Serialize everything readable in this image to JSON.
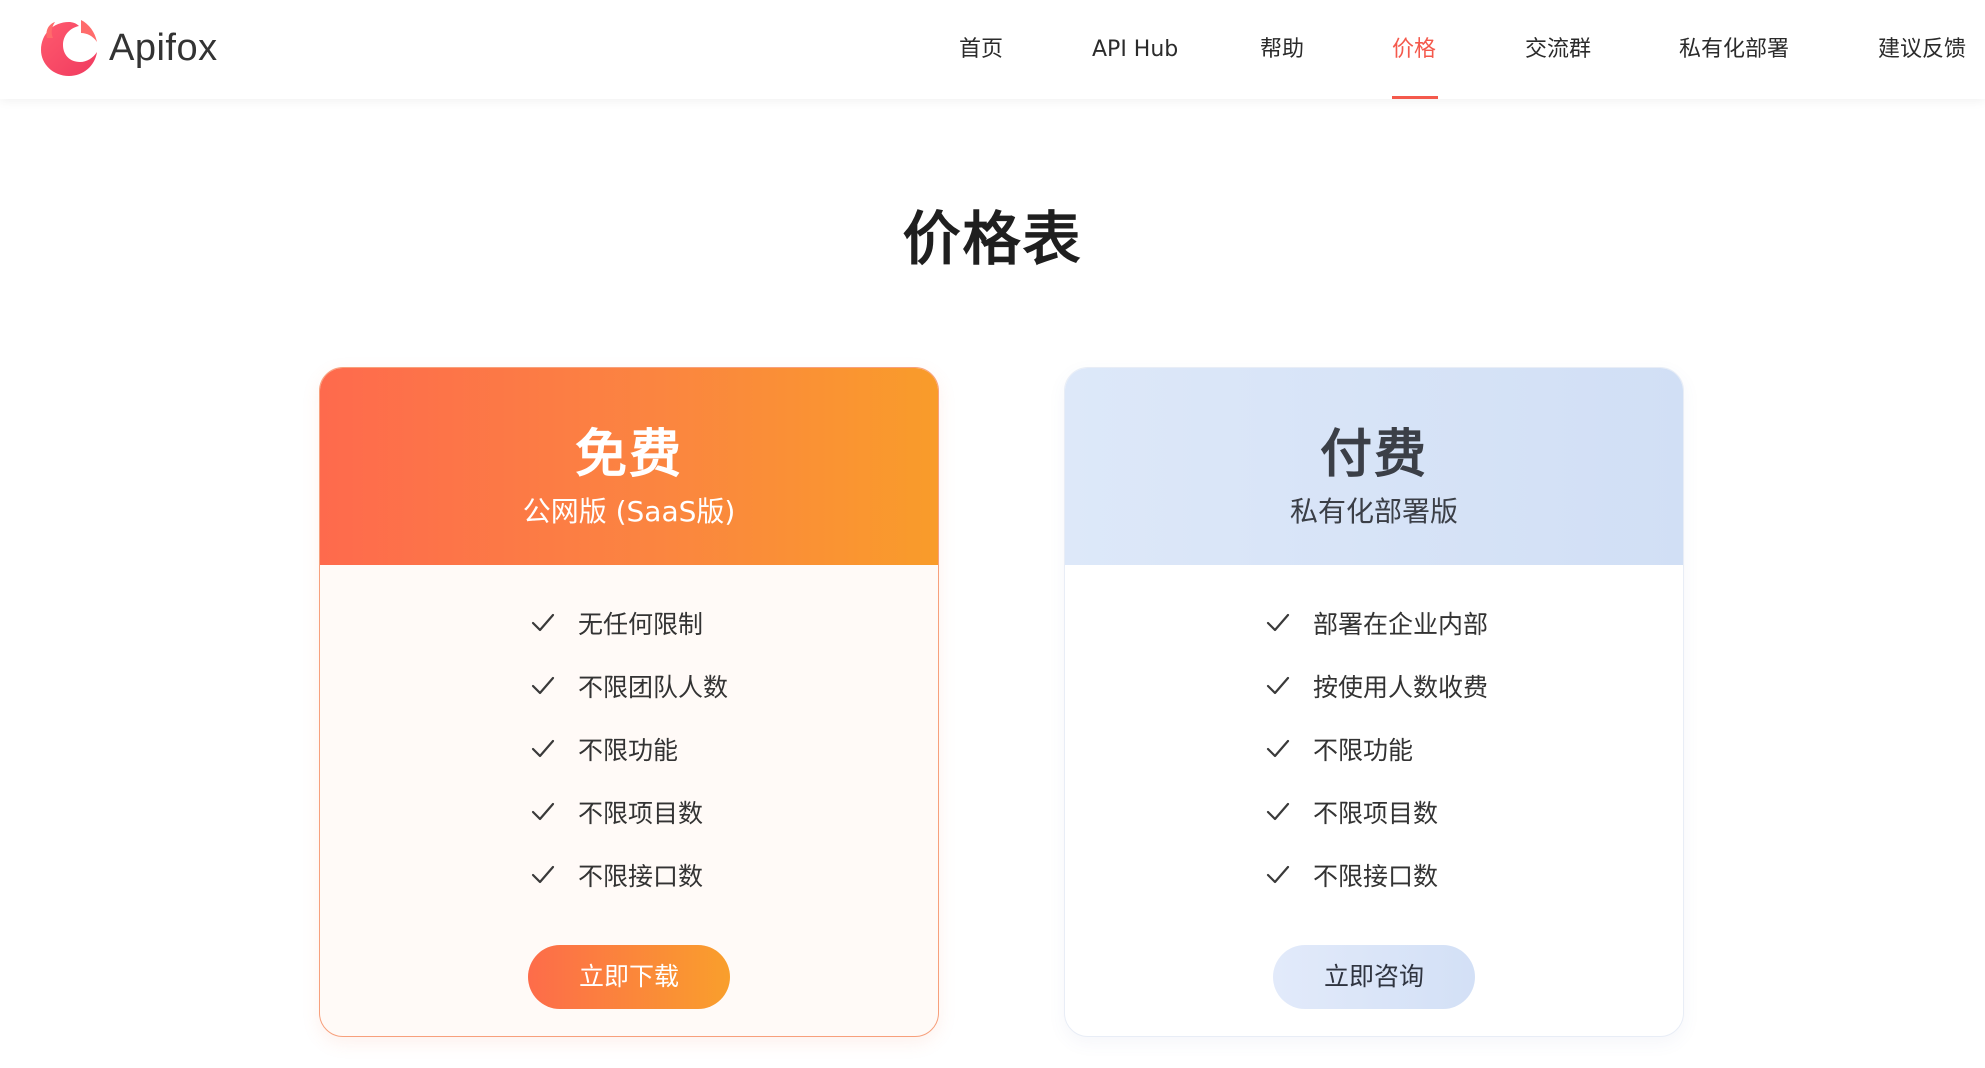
{
  "brand": {
    "name": "Apifox",
    "accent": "#f4594c"
  },
  "nav": {
    "items": [
      {
        "label": "首页"
      },
      {
        "label": "API Hub"
      },
      {
        "label": "帮助"
      },
      {
        "label": "价格"
      },
      {
        "label": "交流群"
      },
      {
        "label": "私有化部署"
      },
      {
        "label": "建议反馈"
      }
    ],
    "active": "价格"
  },
  "page": {
    "title": "价格表"
  },
  "plans": [
    {
      "title": "免费",
      "subtitle": "公网版 (SaaS版)",
      "features": [
        "无任何限制",
        "不限团队人数",
        "不限功能",
        "不限项目数",
        "不限接口数"
      ],
      "button": "立即下载",
      "colors": {
        "head_start": "#fe6a4d",
        "head_end": "#f99c2a"
      }
    },
    {
      "title": "付费",
      "subtitle": "私有化部署版",
      "features": [
        "部署在企业内部",
        "按使用人数收费",
        "不限功能",
        "不限项目数",
        "不限接口数"
      ],
      "button": "立即咨询",
      "colors": {
        "head_start": "#dde8f9",
        "head_end": "#d1dff5"
      }
    }
  ],
  "icons": {
    "logo": "apifox-logo-icon",
    "feature_check": "check-icon"
  }
}
